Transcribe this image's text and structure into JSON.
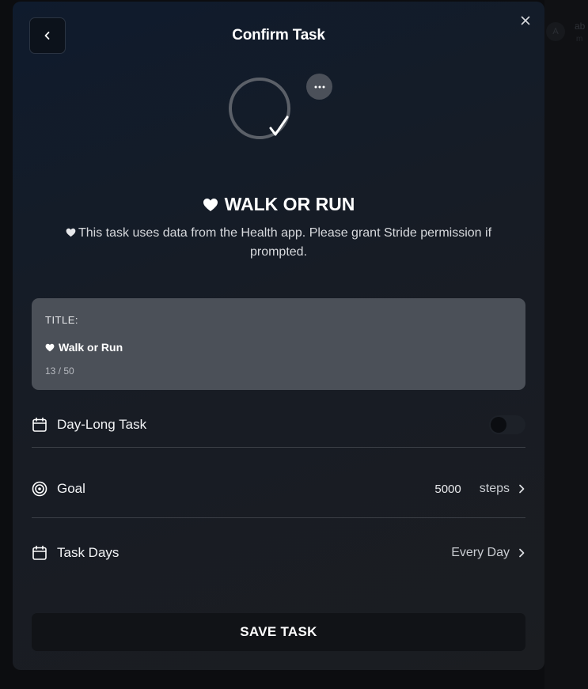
{
  "modal": {
    "title": "Confirm Task",
    "back_icon": "chevron-left-icon",
    "close_icon": "close-icon",
    "more_icon": "ellipsis-icon"
  },
  "task": {
    "heading": "WALK OR RUN",
    "heading_icon": "heart-icon",
    "description": "This task uses data from the Health app. Please grant Stride permission if prompted."
  },
  "title_field": {
    "label": "TITLE:",
    "value": "Walk or Run",
    "counter": "13 / 50"
  },
  "rows": {
    "day_long": {
      "label": "Day-Long Task",
      "icon": "calendar-icon",
      "enabled": false
    },
    "goal": {
      "label": "Goal",
      "icon": "target-icon",
      "value": "5000",
      "unit": "steps"
    },
    "task_days": {
      "label": "Task Days",
      "icon": "calendar-icon",
      "value": "Every Day"
    }
  },
  "save_button": {
    "label": "SAVE TASK"
  },
  "background": {
    "avatar_letter": "A",
    "text_line1": "ab",
    "text_line2": "m"
  },
  "colors": {
    "modal_gradient_start": "#0f1b2d",
    "card_bg": "#4b5058",
    "button_bg": "#111317"
  }
}
